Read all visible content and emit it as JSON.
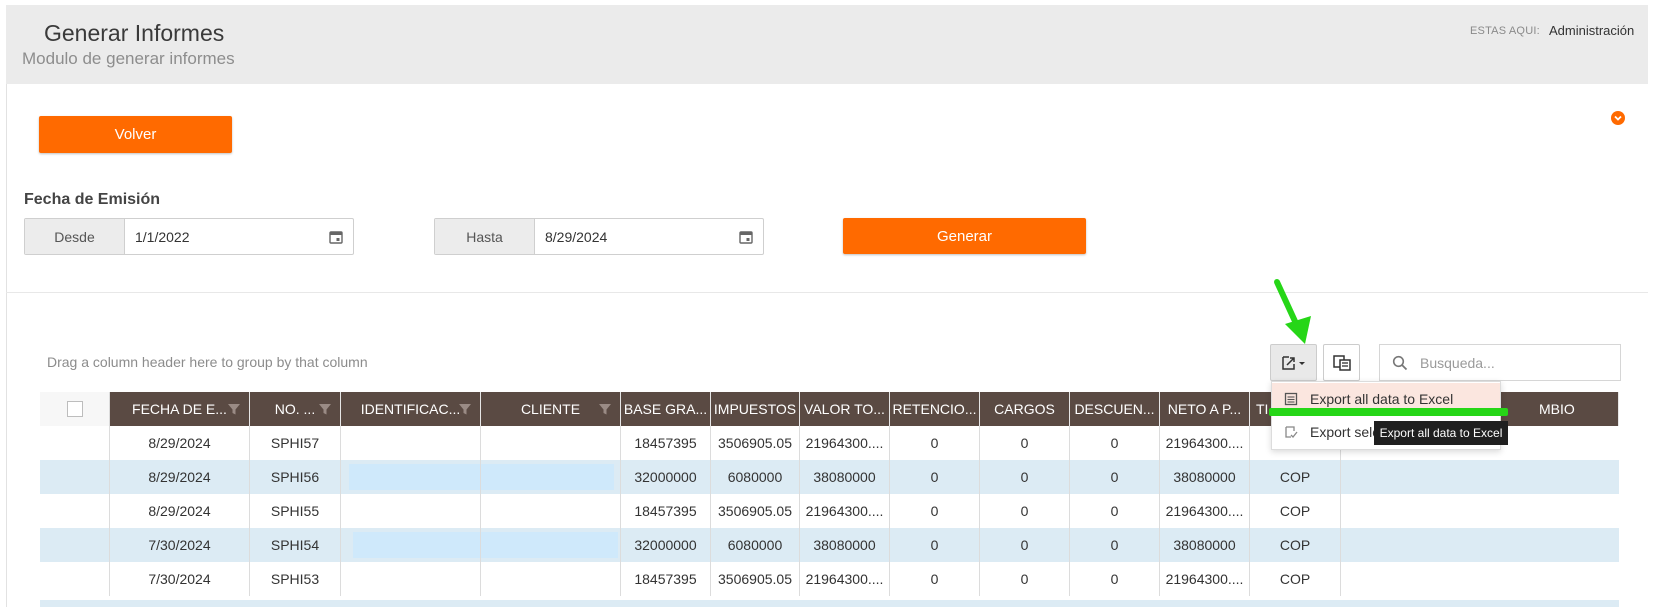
{
  "header": {
    "title": "Generar Informes",
    "subtitle": "Modulo de generar informes",
    "breadcrumb_label": "ESTAS AQUI:",
    "breadcrumb_value": "Administración"
  },
  "actions": {
    "back_label": "Volver",
    "generate_label": "Generar"
  },
  "filters": {
    "section_label": "Fecha de Emisión",
    "from_label": "Desde",
    "from_value": "1/1/2022",
    "to_label": "Hasta",
    "to_value": "8/29/2024"
  },
  "grid": {
    "group_hint": "Drag a column header here to group by that column",
    "search_placeholder": "Busqueda...",
    "columns": [
      "FECHA DE E...",
      "NO. ...",
      "IDENTIFICAC...",
      "CLIENTE",
      "BASE GRA...",
      "IMPUESTOS",
      "VALOR TO...",
      "RETENCIO...",
      "CARGOS",
      "DESCUEN...",
      "NETO A P...",
      "TI",
      "MBIO"
    ],
    "rows": [
      [
        "8/29/2024",
        "SPHI57",
        "",
        "",
        "18457395",
        "3506905.05",
        "21964300....",
        "0",
        "0",
        "0",
        "21964300....",
        "",
        ""
      ],
      [
        "8/29/2024",
        "SPHI56",
        "",
        "",
        "32000000",
        "6080000",
        "38080000",
        "0",
        "0",
        "0",
        "38080000",
        "COP",
        ""
      ],
      [
        "8/29/2024",
        "SPHI55",
        "",
        "",
        "18457395",
        "3506905.05",
        "21964300....",
        "0",
        "0",
        "0",
        "21964300....",
        "COP",
        ""
      ],
      [
        "7/30/2024",
        "SPHI54",
        "",
        "",
        "32000000",
        "6080000",
        "38080000",
        "0",
        "0",
        "0",
        "38080000",
        "COP",
        ""
      ],
      [
        "7/30/2024",
        "SPHI53",
        "",
        "",
        "18457395",
        "3506905.05",
        "21964300....",
        "0",
        "0",
        "0",
        "21964300....",
        "COP",
        ""
      ]
    ]
  },
  "export_menu": {
    "item_all": "Export all data to Excel",
    "item_selected": "Export sele",
    "tooltip": "Export all data to Excel"
  },
  "colors": {
    "accent": "#ff6a00",
    "header_bg": "#5a4a43",
    "row_alt": "#dcebf4",
    "annotation": "#26d617"
  }
}
